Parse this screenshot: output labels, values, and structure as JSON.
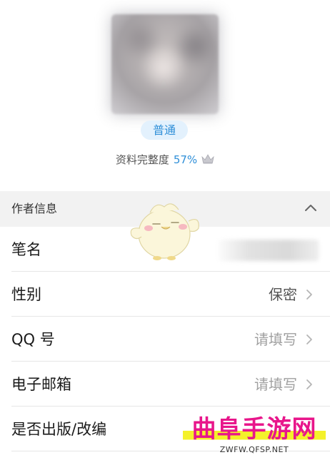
{
  "profile": {
    "level_badge": "普通",
    "completion_label": "资料完整度",
    "completion_percent": "57%",
    "crown_icon": "crown-icon"
  },
  "section": {
    "title": "作者信息",
    "collapse_icon": "chevron-up-icon"
  },
  "rows": [
    {
      "label": "笔名",
      "value": ""
    },
    {
      "label": "性别",
      "value": "保密"
    },
    {
      "label": "QQ 号",
      "value": "请填写"
    },
    {
      "label": "电子邮箱",
      "value": "请填写"
    },
    {
      "label": "是否出版/改编",
      "value": ""
    }
  ],
  "watermark": {
    "title": "曲阜手游网",
    "url": "ZWFW.QFSP.NET"
  },
  "colors": {
    "accent": "#2f8fd8",
    "badge_bg": "#e3f1fd",
    "section_bg": "#f2f2f2",
    "placeholder": "#a0a0a0",
    "watermark_pink": "#e8168b",
    "watermark_yellow": "#f4f12a"
  }
}
